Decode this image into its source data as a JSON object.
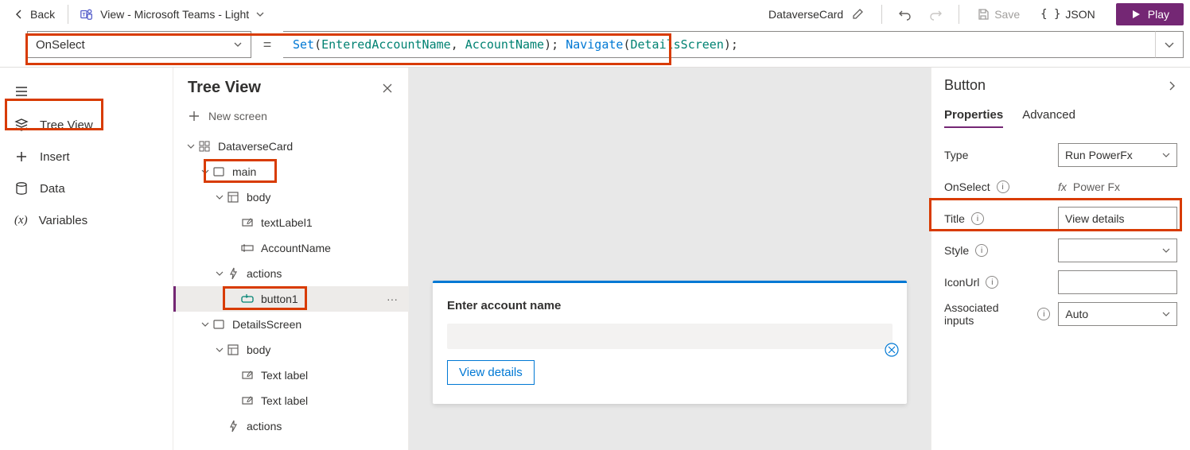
{
  "topbar": {
    "back_label": "Back",
    "theme_label": "View - Microsoft Teams - Light",
    "card_name": "DataverseCard",
    "save_label": "Save",
    "json_label": "JSON",
    "play_label": "Play"
  },
  "formula": {
    "property": "OnSelect",
    "expression_tokens": [
      {
        "t": "fn",
        "v": "Set"
      },
      {
        "t": "text",
        "v": "("
      },
      {
        "t": "var",
        "v": "EnteredAccountName"
      },
      {
        "t": "text",
        "v": ", "
      },
      {
        "t": "var",
        "v": "AccountName"
      },
      {
        "t": "text",
        "v": "); "
      },
      {
        "t": "fn",
        "v": "Navigate"
      },
      {
        "t": "text",
        "v": "("
      },
      {
        "t": "var",
        "v": "DetailsScreen"
      },
      {
        "t": "text",
        "v": ");"
      }
    ]
  },
  "rail": {
    "items": [
      {
        "icon": "layers",
        "label": "Tree View"
      },
      {
        "icon": "plus",
        "label": "Insert"
      },
      {
        "icon": "data",
        "label": "Data"
      },
      {
        "icon": "vars",
        "label": "Variables"
      }
    ],
    "active": 0
  },
  "tree": {
    "title": "Tree View",
    "new_screen_label": "New screen",
    "nodes": [
      {
        "depth": 0,
        "chev": "down",
        "icon": "app",
        "label": "DataverseCard"
      },
      {
        "depth": 1,
        "chev": "down",
        "icon": "screen",
        "label": "main"
      },
      {
        "depth": 2,
        "chev": "down",
        "icon": "container",
        "label": "body"
      },
      {
        "depth": 3,
        "chev": "none",
        "icon": "textlabel",
        "label": "textLabel1"
      },
      {
        "depth": 3,
        "chev": "none",
        "icon": "textinput",
        "label": "AccountName"
      },
      {
        "depth": 2,
        "chev": "down",
        "icon": "actions",
        "label": "actions"
      },
      {
        "depth": 3,
        "chev": "none",
        "icon": "button",
        "label": "button1",
        "selected": true,
        "more": true
      },
      {
        "depth": 1,
        "chev": "down",
        "icon": "screen",
        "label": "DetailsScreen"
      },
      {
        "depth": 2,
        "chev": "down",
        "icon": "container",
        "label": "body"
      },
      {
        "depth": 3,
        "chev": "none",
        "icon": "textlabel",
        "label": "Text label"
      },
      {
        "depth": 3,
        "chev": "none",
        "icon": "textlabel",
        "label": "Text label"
      },
      {
        "depth": 2,
        "chev": "none",
        "icon": "actions",
        "label": "actions"
      }
    ]
  },
  "canvas": {
    "card_label": "Enter account name",
    "button_label": "View details"
  },
  "props": {
    "component": "Button",
    "tabs": [
      "Properties",
      "Advanced"
    ],
    "active_tab": 0,
    "rows": [
      {
        "label": "Type",
        "ctrl": "select",
        "value": "Run PowerFx"
      },
      {
        "label": "OnSelect",
        "info": true,
        "ctrl": "fx",
        "value": "Power Fx"
      },
      {
        "label": "Title",
        "info": true,
        "ctrl": "text",
        "value": "View details"
      },
      {
        "label": "Style",
        "info": true,
        "ctrl": "select",
        "value": ""
      },
      {
        "label": "IconUrl",
        "info": true,
        "ctrl": "text",
        "value": ""
      },
      {
        "label": "Associated inputs",
        "info": true,
        "ctrl": "select",
        "value": "Auto"
      }
    ]
  }
}
